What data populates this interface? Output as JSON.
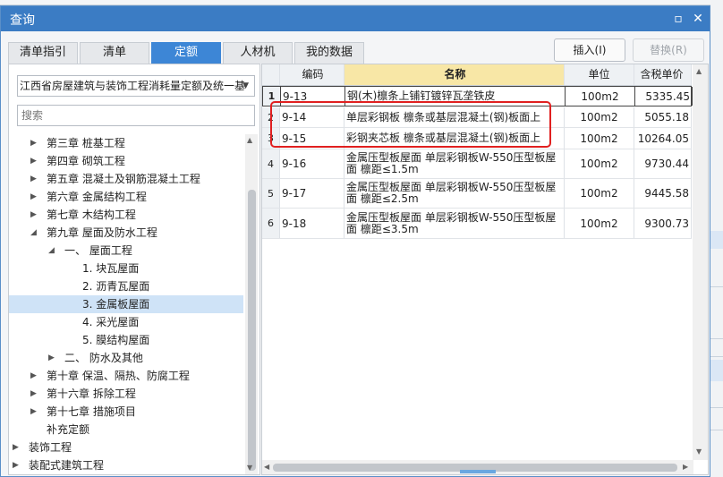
{
  "window": {
    "title": "查询"
  },
  "tabs": [
    {
      "label": "清单指引"
    },
    {
      "label": "清单"
    },
    {
      "label": "定额"
    },
    {
      "label": "人材机"
    },
    {
      "label": "我的数据"
    }
  ],
  "buttons": {
    "insert": "插入(I)",
    "replace": "替换(R)"
  },
  "quota_select": {
    "value": "江西省房屋建筑与装饰工程消耗量定额及统一基"
  },
  "search": {
    "placeholder": "搜索"
  },
  "tree": [
    {
      "label": "第三章 桩基工程"
    },
    {
      "label": "第四章 砌筑工程"
    },
    {
      "label": "第五章 混凝土及钢筋混凝土工程"
    },
    {
      "label": "第六章 金属结构工程"
    },
    {
      "label": "第七章 木结构工程"
    },
    {
      "label": "第九章 屋面及防水工程"
    },
    {
      "label": "一、 屋面工程"
    },
    {
      "label": "1. 块瓦屋面"
    },
    {
      "label": "2. 沥青瓦屋面"
    },
    {
      "label": "3. 金属板屋面"
    },
    {
      "label": "4. 采光屋面"
    },
    {
      "label": "5. 膜结构屋面"
    },
    {
      "label": "二、 防水及其他"
    },
    {
      "label": "第十章 保温、隔热、防腐工程"
    },
    {
      "label": "第十六章 拆除工程"
    },
    {
      "label": "第十七章 措施项目"
    },
    {
      "label": "补充定额"
    },
    {
      "label": "装饰工程"
    },
    {
      "label": "装配式建筑工程"
    }
  ],
  "grid": {
    "headers": {
      "code": "编码",
      "name": "名称",
      "unit": "单位",
      "price": "含税单价"
    },
    "rows": [
      {
        "idx": "1",
        "code": "9-13",
        "name": "钢(木)檩条上铺钉镀锌瓦垄铁皮",
        "unit": "100m2",
        "price": "5335.45"
      },
      {
        "idx": "2",
        "code": "9-14",
        "name": "单层彩钢板 檩条或基层混凝土(钢)板面上",
        "unit": "100m2",
        "price": "5055.18"
      },
      {
        "idx": "3",
        "code": "9-15",
        "name": "彩钢夹芯板 檩条或基层混凝土(钢)板面上",
        "unit": "100m2",
        "price": "10264.05"
      },
      {
        "idx": "4",
        "code": "9-16",
        "name": "金属压型板屋面 单层彩钢板W-550压型板屋面 檩距≤1.5m",
        "unit": "100m2",
        "price": "9730.44"
      },
      {
        "idx": "5",
        "code": "9-17",
        "name": "金属压型板屋面 单层彩钢板W-550压型板屋面 檩距≤2.5m",
        "unit": "100m2",
        "price": "9445.58"
      },
      {
        "idx": "6",
        "code": "9-18",
        "name": "金属压型板屋面 单层彩钢板W-550压型板屋面 檩距≤3.5m",
        "unit": "100m2",
        "price": "9300.73"
      }
    ]
  },
  "colors": {
    "titlebar": "#3b7cc4",
    "active_tab": "#3d86d6",
    "name_header": "#f8e7a6",
    "highlight": "#e02020",
    "tree_selected": "#cfe3f7"
  }
}
